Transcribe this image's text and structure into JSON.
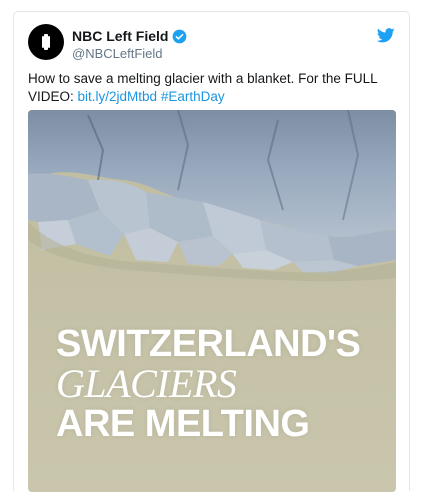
{
  "tweet": {
    "author_name": "NBC Left Field",
    "author_handle": "@NBCLeftField",
    "verified": true,
    "text_prefix": "How to save a melting glacier with a blanket. For the FULL VIDEO:",
    "link_text": "bit.ly/2jdMtbd",
    "hashtag_text": "#EarthDay",
    "link_color": "#1b95e0"
  },
  "media": {
    "caption_line1": "SWITZERLAND'S",
    "caption_line2": "GLACIERS",
    "caption_line3": "ARE MELTING"
  },
  "icons": {
    "avatar": "nbc-left-field-logo",
    "verified": "verified-badge-icon",
    "platform": "twitter-bird-icon"
  }
}
